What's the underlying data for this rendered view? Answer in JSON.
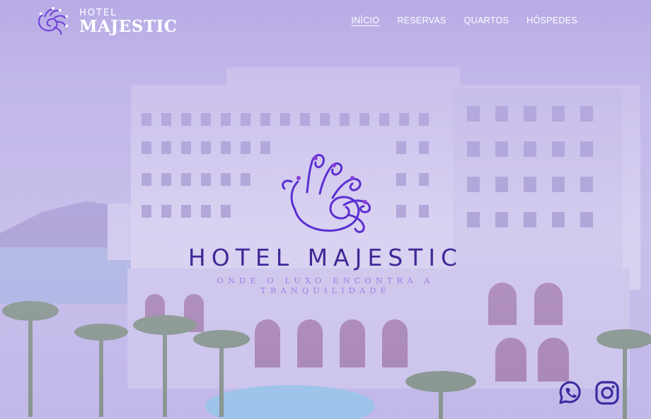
{
  "brand": {
    "small": "HOTEL",
    "name": "MAJESTIC"
  },
  "nav": {
    "items": [
      {
        "label": "INÍCIO",
        "active": true
      },
      {
        "label": "RESERVAS",
        "active": false
      },
      {
        "label": "QUARTOS",
        "active": false
      },
      {
        "label": "HÓSPEDES",
        "active": false
      }
    ]
  },
  "hero": {
    "title": "HOTEL MAJESTIC",
    "tagline": "ONDE O LUXO ENCONTRA A TRANQUILIDADE"
  },
  "social": {
    "icons": [
      "whatsapp-icon",
      "instagram-icon"
    ]
  },
  "colors": {
    "overlay": "#b9b0e0",
    "title": "#3f2a96",
    "tagline": "#9d7fe6",
    "emblem": "#5b2fd0",
    "social_icon": "#3a2aa0"
  }
}
